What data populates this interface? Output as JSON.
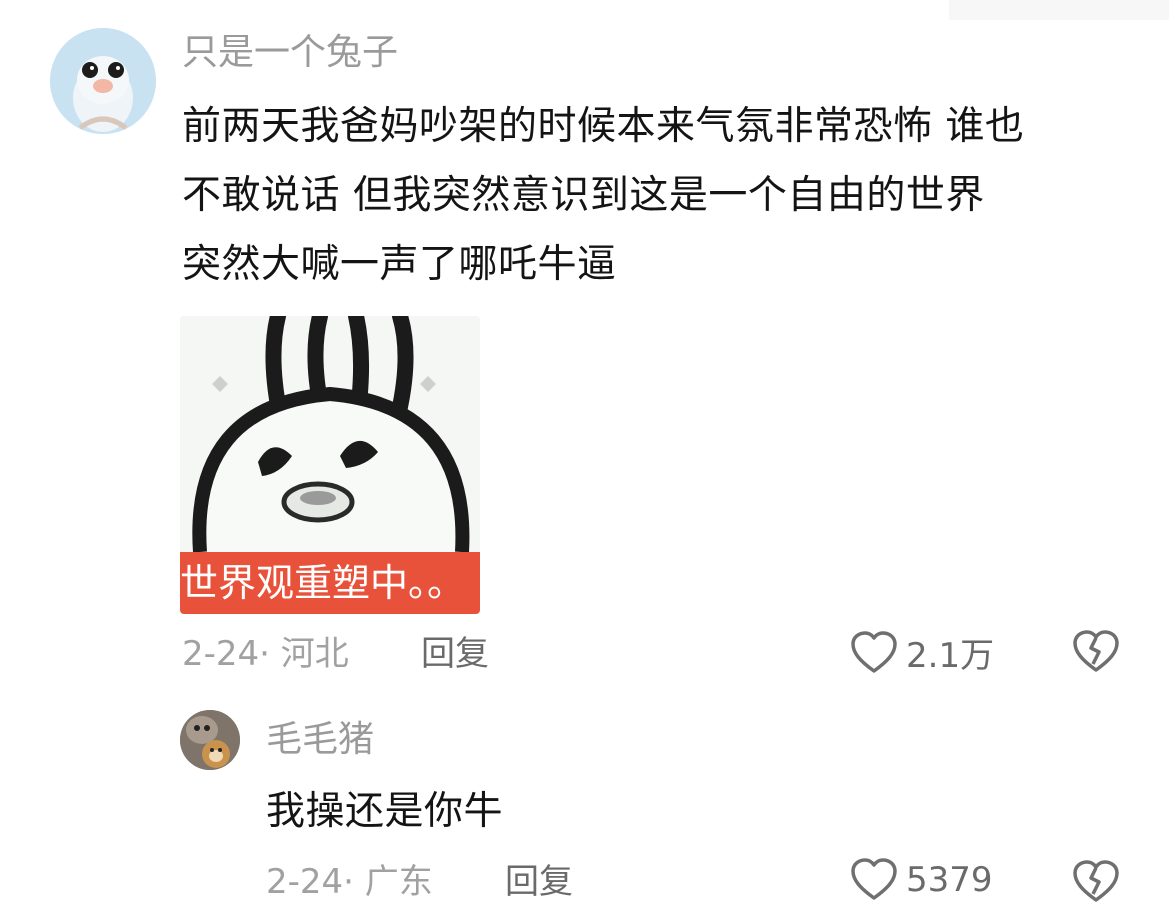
{
  "comment": {
    "username": "只是一个兔子",
    "lines": [
      "前两天我爸妈吵架的时候本来气氛非常恐怖 谁也",
      "不敢说话 但我突然意识到这是一个自由的世界",
      "突然大喊一声了哪吒牛逼"
    ],
    "sticker_caption": "世界观重塑中。。",
    "meta": "2-24· 河北",
    "reply_label": "回复",
    "likes": "2.1万"
  },
  "reply": {
    "username": "毛毛猪",
    "text": "我操还是你牛",
    "meta": "2-24· 广东",
    "reply_label": "回复",
    "likes": "5379"
  },
  "icons": {
    "like": "heart-outline-icon",
    "dislike": "broken-heart-icon"
  },
  "colors": {
    "caption_bg": "#e8523a",
    "meta_gray": "#a1a1a1",
    "username_gray": "#9a9a9a"
  }
}
